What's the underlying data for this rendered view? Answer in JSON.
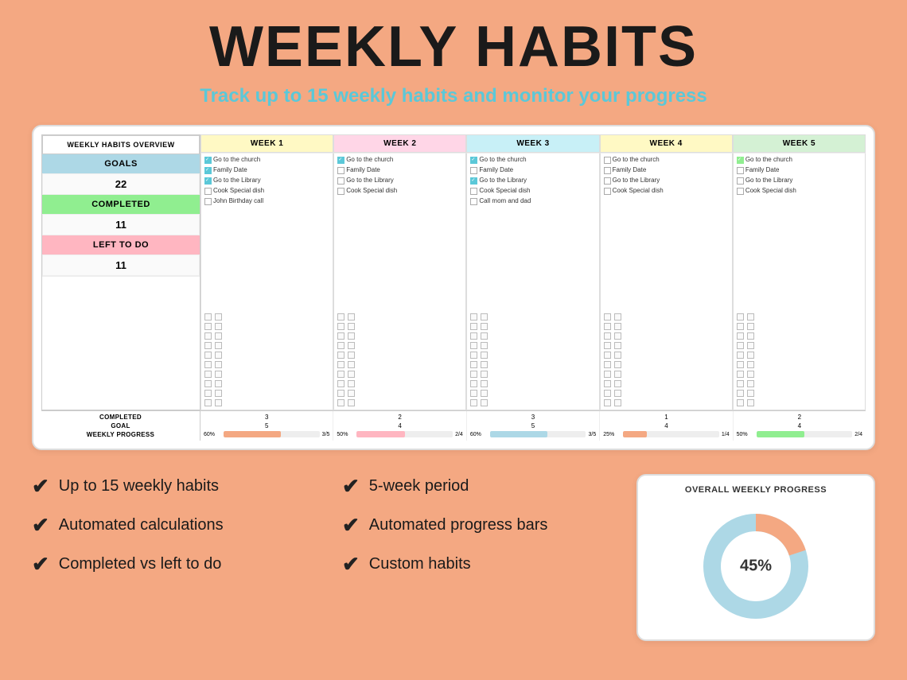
{
  "header": {
    "title": "WEEKLY HABITS",
    "subtitle": "Track up to 15 weekly habits and monitor your progress"
  },
  "spreadsheet": {
    "left_panel": {
      "header": "WEEKLY HABITS OVERVIEW",
      "goals_label": "GOALS",
      "goals_value": "22",
      "completed_label": "COMPLETED",
      "completed_value": "11",
      "lefttodo_label": "LEFT TO DO",
      "lefttodo_value": "11"
    },
    "weeks": [
      {
        "label": "WEEK 1",
        "color_class": "w1",
        "tasks": [
          "Go to the church",
          "Family Date",
          "Go to the Library",
          "Cook Special dish",
          "John Birthday call"
        ],
        "checked": [
          true,
          true,
          true,
          false,
          false
        ],
        "stats": {
          "completed": "3",
          "goal": "5",
          "fraction": "3/5",
          "pct": "60%",
          "bar_pct": 60,
          "bar_color": "#f4a882"
        }
      },
      {
        "label": "WEEK 2",
        "color_class": "w2",
        "tasks": [
          "Go to the church",
          "Family Date",
          "Go to the Library",
          "Cook Special dish"
        ],
        "checked": [
          true,
          false,
          false,
          false
        ],
        "stats": {
          "completed": "2",
          "goal": "4",
          "fraction": "2/4",
          "pct": "50%",
          "bar_pct": 50,
          "bar_color": "#ffb6c1"
        }
      },
      {
        "label": "WEEK 3",
        "color_class": "w3",
        "tasks": [
          "Go to the church",
          "Family Date",
          "Go to the Library",
          "Cook Special dish",
          "Call mom and dad"
        ],
        "checked": [
          true,
          false,
          true,
          false,
          false
        ],
        "stats": {
          "completed": "3",
          "goal": "5",
          "fraction": "3/5",
          "pct": "60%",
          "bar_pct": 60,
          "bar_color": "#add8e6"
        }
      },
      {
        "label": "WEEK 4",
        "color_class": "w4",
        "tasks": [
          "Go to the church",
          "Family Date",
          "Go to the Library",
          "Cook Special dish"
        ],
        "checked": [
          false,
          false,
          false,
          false
        ],
        "stats": {
          "completed": "1",
          "goal": "4",
          "fraction": "1/4",
          "pct": "25%",
          "bar_pct": 25,
          "bar_color": "#f4a882"
        }
      },
      {
        "label": "WEEK 5",
        "color_class": "w5",
        "tasks": [
          "Go to the church",
          "Family Date",
          "Go to the Library",
          "Cook Special dish"
        ],
        "checked": [
          true,
          false,
          false,
          false
        ],
        "stats": {
          "completed": "2",
          "goal": "4",
          "fraction": "2/4",
          "pct": "50%",
          "bar_pct": 50,
          "bar_color": "#90ee90"
        }
      }
    ],
    "stats_labels": {
      "completed": "COMPLETED",
      "goal": "GOAL",
      "progress": "WEEKLY PROGRESS"
    }
  },
  "features": [
    {
      "id": "f1",
      "text": "Up to 15 weekly habits"
    },
    {
      "id": "f2",
      "text": "5-week period"
    },
    {
      "id": "f3",
      "text": "Automated calculations"
    },
    {
      "id": "f4",
      "text": "Automated progress bars"
    },
    {
      "id": "f5",
      "text": "Completed vs left to do"
    },
    {
      "id": "f6",
      "text": "Custom habits"
    }
  ],
  "progress_widget": {
    "title": "OVERALL WEEKLY PROGRESS",
    "percentage": "45%",
    "pct_value": 45,
    "colors": {
      "filled": "#f4a882",
      "empty": "#add8e6"
    }
  }
}
